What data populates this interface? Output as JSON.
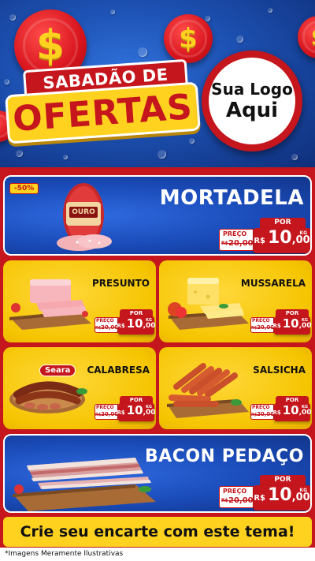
{
  "header": {
    "title_top": "SABADÃO DE",
    "title_main": "OFERTAS",
    "coin_symbol": "$",
    "logo_line1": "Sua Logo",
    "logo_line2": "Aqui"
  },
  "featured": [
    {
      "name": "MORTADELA",
      "badge": "-50%",
      "por": "POR",
      "preco": "PREÇO",
      "old_prefix": "R$",
      "old_price": "20,00",
      "currency": "R$",
      "price_int": "10",
      "price_dec": ",00",
      "unit": "KG"
    },
    {
      "name": "BACON PEDAÇO",
      "por": "POR",
      "preco": "PREÇO",
      "old_prefix": "R$",
      "old_price": "20,00",
      "currency": "R$",
      "price_int": "10",
      "price_dec": ",00",
      "unit": "KG"
    }
  ],
  "products": [
    {
      "name": "PRESUNTO",
      "por": "POR",
      "preco": "PREÇO",
      "old_prefix": "R$",
      "old_price": "20,00",
      "currency": "R$",
      "price_int": "10",
      "price_dec": ",00",
      "unit": "KG"
    },
    {
      "name": "MUSSARELA",
      "por": "POR",
      "preco": "PREÇO",
      "old_prefix": "R$",
      "old_price": "20,00",
      "currency": "R$",
      "price_int": "10",
      "price_dec": ",00",
      "unit": "KG"
    },
    {
      "name": "CALABRESA",
      "brand": "Seara",
      "por": "POR",
      "preco": "PREÇO",
      "old_prefix": "R$",
      "old_price": "20,00",
      "currency": "R$",
      "price_int": "10",
      "price_dec": ",00",
      "unit": "KG"
    },
    {
      "name": "SALSICHA",
      "por": "POR",
      "preco": "PREÇO",
      "old_prefix": "R$",
      "old_price": "20,00",
      "currency": "R$",
      "price_int": "10",
      "price_dec": ",00",
      "unit": "KG"
    }
  ],
  "mortadela_brand": "OURO",
  "cta": "Crie seu encarte com este tema!",
  "footnote": "*Imagens Meramente Ilustrativas",
  "colors": {
    "red": "#c4161c",
    "yellow": "#ffd21f",
    "blue": "#1a4bb8"
  }
}
